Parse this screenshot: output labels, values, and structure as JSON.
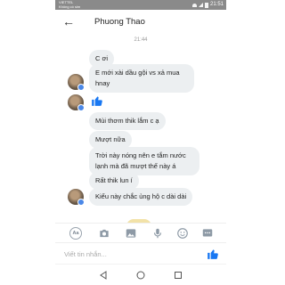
{
  "status_bar": {
    "carrier_line1": "VIETTEL",
    "carrier_line2": "Không có sim",
    "battery": "",
    "time": "21:51"
  },
  "header": {
    "back_icon": "arrow-left-icon",
    "title": "Phuong Thao"
  },
  "chat": {
    "timestamp": "21:44",
    "messages": [
      {
        "text": "C ơi"
      },
      {
        "text": "E mới xài dầu gội vs xả mua hnay"
      },
      {
        "text": "Mùi thơm thik lắm c ạ"
      },
      {
        "text": "Mượt nữa"
      },
      {
        "text": "Trời này nóng nên e tắm nước lạnh mà đã mượt thế này á"
      },
      {
        "text": "Rất thik lun í"
      },
      {
        "text": "Kiểu này chắc ủng hộ c dài dài"
      }
    ],
    "like_icon": "thumbs-up-icon"
  },
  "toolbar": {
    "items": [
      "text-style-icon",
      "camera-icon",
      "image-icon",
      "microphone-icon",
      "emoji-icon",
      "more-icon"
    ],
    "aa_label": "Aa"
  },
  "composer": {
    "placeholder": "Viết tin nhắn..."
  },
  "colors": {
    "bubble": "#eceff1",
    "accent": "#1877f2",
    "status_bar": "#8a8a8a"
  }
}
